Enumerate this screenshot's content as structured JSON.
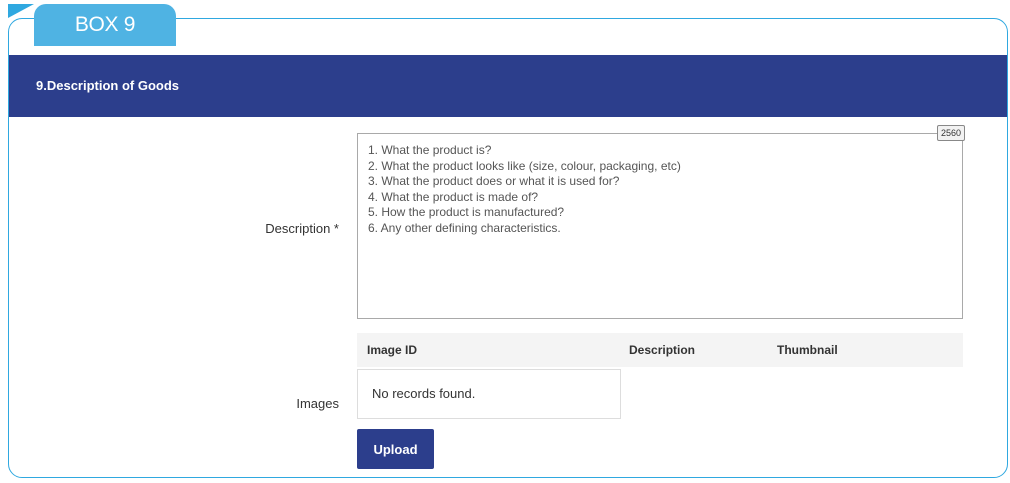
{
  "box_tab": {
    "label": "BOX 9"
  },
  "section": {
    "title": "9.Description of Goods"
  },
  "description": {
    "label": "Description *",
    "value": "1. What the product is?\n2. What the product looks like (size, colour, packaging, etc)\n3. What the product does or what it is used for?\n4. What the product is made of?\n5. How the product is manufactured?\n6. Any other defining characteristics.",
    "char_counter": "2560"
  },
  "images": {
    "label": "Images",
    "columns": [
      "Image ID",
      "Description",
      "Thumbnail"
    ],
    "empty_message": "No records found.",
    "upload_label": "Upload"
  },
  "colors": {
    "header_bg": "#2c3e8c",
    "tab_bg": "#4fb3e3",
    "frame_border": "#2fa8e0"
  }
}
